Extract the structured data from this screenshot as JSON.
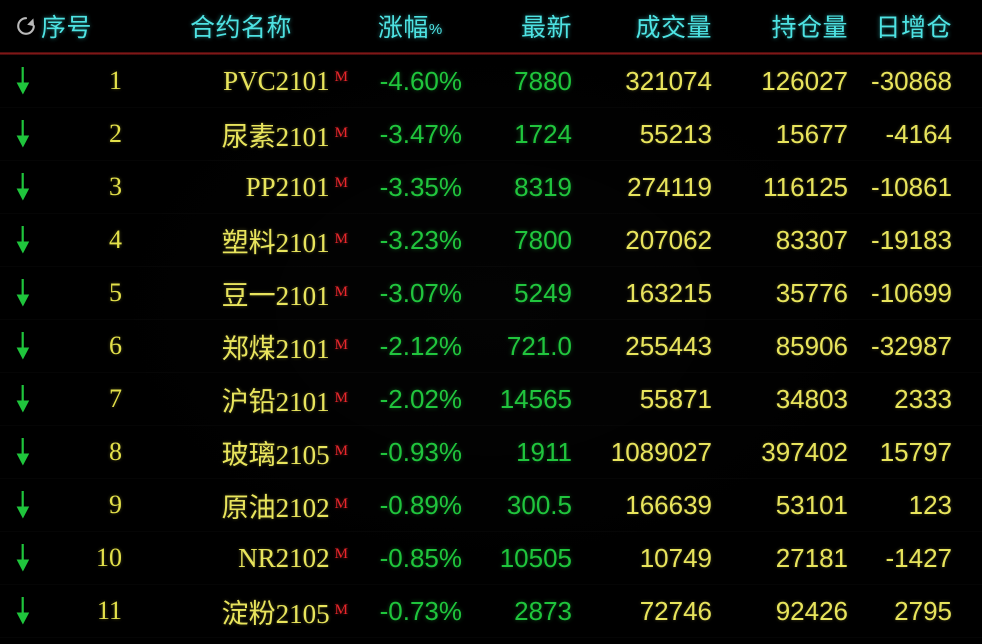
{
  "header": {
    "refresh_icon": "refresh-icon",
    "columns": {
      "seq": "序号",
      "name": "合约名称",
      "change_pct": "涨幅",
      "change_pct_sign": "%",
      "last": "最新",
      "volume": "成交量",
      "open_interest": "持仓量",
      "daily_oi_change": "日增仓"
    },
    "text_color": "#4ee3e3",
    "separator_color": "#8d1a1a"
  },
  "colors": {
    "background": "#000000",
    "down": "#1fc53c",
    "up": "#e8262b",
    "yellow": "#e8e45c",
    "cyan": "#4ee3e3",
    "m_flag": "#e8262b"
  },
  "rows": [
    {
      "trend_icon": "arrow-down-icon",
      "index": "1",
      "name": "PVC2101",
      "flag": "M",
      "change_pct": "-4.60%",
      "last": "7880",
      "volume": "321074",
      "open_interest": "126027",
      "daily_oi_change": "-30868"
    },
    {
      "trend_icon": "arrow-down-icon",
      "index": "2",
      "name": "尿素2101",
      "flag": "M",
      "change_pct": "-3.47%",
      "last": "1724",
      "volume": "55213",
      "open_interest": "15677",
      "daily_oi_change": "-4164"
    },
    {
      "trend_icon": "arrow-down-icon",
      "index": "3",
      "name": "PP2101",
      "flag": "M",
      "change_pct": "-3.35%",
      "last": "8319",
      "volume": "274119",
      "open_interest": "116125",
      "daily_oi_change": "-10861"
    },
    {
      "trend_icon": "arrow-down-icon",
      "index": "4",
      "name": "塑料2101",
      "flag": "M",
      "change_pct": "-3.23%",
      "last": "7800",
      "volume": "207062",
      "open_interest": "83307",
      "daily_oi_change": "-19183"
    },
    {
      "trend_icon": "arrow-down-icon",
      "index": "5",
      "name": "豆一2101",
      "flag": "M",
      "change_pct": "-3.07%",
      "last": "5249",
      "volume": "163215",
      "open_interest": "35776",
      "daily_oi_change": "-10699"
    },
    {
      "trend_icon": "arrow-down-icon",
      "index": "6",
      "name": "郑煤2101",
      "flag": "M",
      "change_pct": "-2.12%",
      "last": "721.0",
      "volume": "255443",
      "open_interest": "85906",
      "daily_oi_change": "-32987"
    },
    {
      "trend_icon": "arrow-down-icon",
      "index": "7",
      "name": "沪铅2101",
      "flag": "M",
      "change_pct": "-2.02%",
      "last": "14565",
      "volume": "55871",
      "open_interest": "34803",
      "daily_oi_change": "2333"
    },
    {
      "trend_icon": "arrow-down-icon",
      "index": "8",
      "name": "玻璃2105",
      "flag": "M",
      "change_pct": "-0.93%",
      "last": "1911",
      "volume": "1089027",
      "open_interest": "397402",
      "daily_oi_change": "15797"
    },
    {
      "trend_icon": "arrow-down-icon",
      "index": "9",
      "name": "原油2102",
      "flag": "M",
      "change_pct": "-0.89%",
      "last": "300.5",
      "volume": "166639",
      "open_interest": "53101",
      "daily_oi_change": "123"
    },
    {
      "trend_icon": "arrow-down-icon",
      "index": "10",
      "name": "NR2102",
      "flag": "M",
      "change_pct": "-0.85%",
      "last": "10505",
      "volume": "10749",
      "open_interest": "27181",
      "daily_oi_change": "-1427"
    },
    {
      "trend_icon": "arrow-down-icon",
      "index": "11",
      "name": "淀粉2105",
      "flag": "M",
      "change_pct": "-0.73%",
      "last": "2873",
      "volume": "72746",
      "open_interest": "92426",
      "daily_oi_change": "2795"
    }
  ]
}
